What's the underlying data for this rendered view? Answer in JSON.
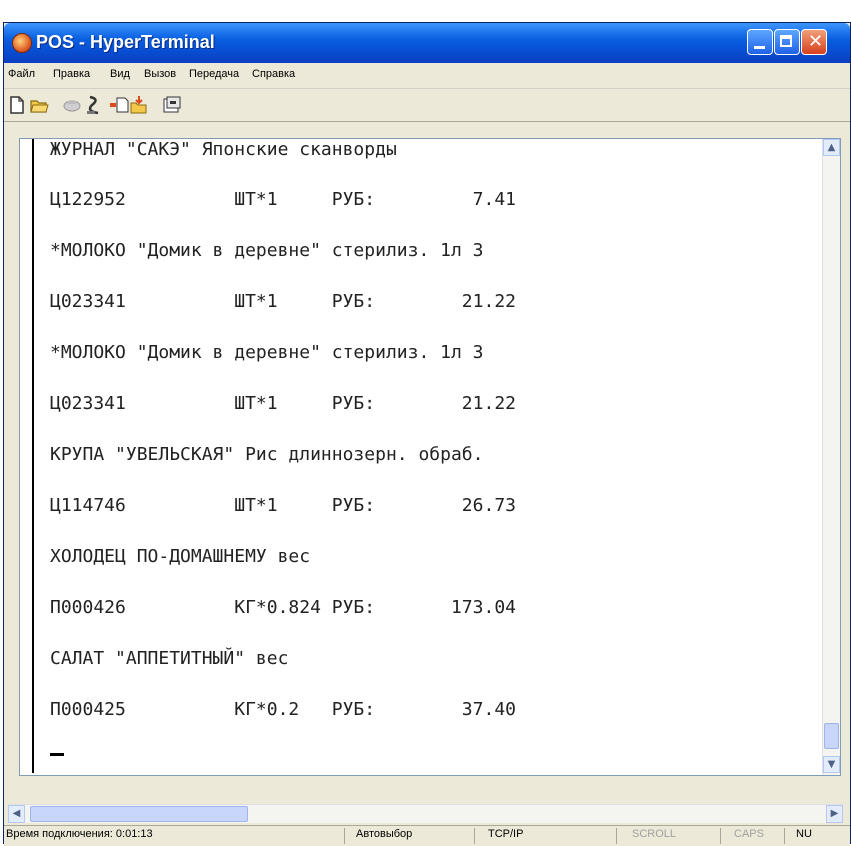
{
  "window": {
    "title": "POS - HyperTerminal",
    "close_glyph": "✕"
  },
  "menu": [
    "Файл",
    "Правка",
    "Вид",
    "Вызов",
    "Передача",
    "Справка"
  ],
  "toolbar": {
    "icons": [
      "new-icon",
      "open-icon",
      "disconnect-icon",
      "dial-icon",
      "send-icon",
      "receive-icon",
      "properties-icon"
    ]
  },
  "terminal": {
    "lines": [
      "ЖУРНАЛ \"САКЭ\" Японские сканворды",
      "Ц122952          ШТ*1     РУБ:         7.41",
      "*МОЛОКО \"Домик в деревне\" стерилиз. 1л 3",
      "Ц023341          ШТ*1     РУБ:        21.22",
      "*МОЛОКО \"Домик в деревне\" стерилиз. 1л 3",
      "Ц023341          ШТ*1     РУБ:        21.22",
      "КРУПА \"УВЕЛЬСКАЯ\" Рис длиннозерн. обраб.",
      "Ц114746          ШТ*1     РУБ:        26.73",
      "ХОЛОДЕЦ ПО-ДОМАШНЕМУ вес",
      "П000426          КГ*0.824 РУБ:       173.04",
      "САЛАТ \"АППЕТИТНЫЙ\" вес",
      "П000425          КГ*0.2   РУБ:        37.40"
    ]
  },
  "statusbar": {
    "connection": "Время подключения: 0:01:13",
    "detect": "Автовыбор",
    "protocol": "TCP/IP",
    "scroll": "SCROLL",
    "caps": "CAPS",
    "num": "NU"
  }
}
